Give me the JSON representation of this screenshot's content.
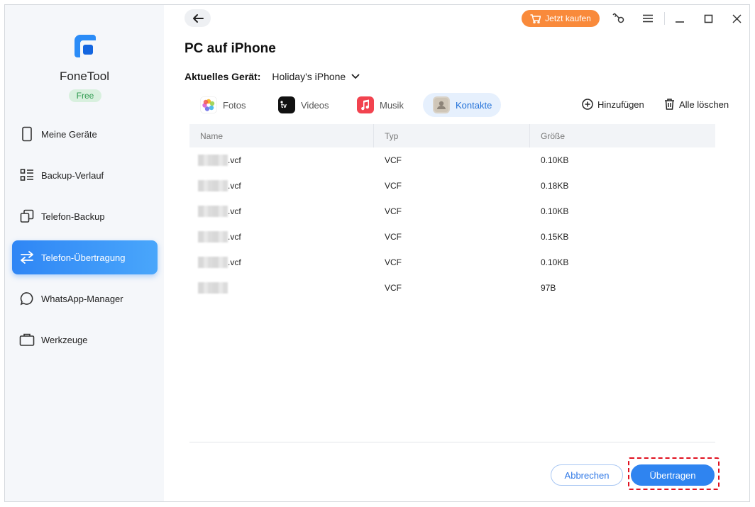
{
  "app": {
    "name": "FoneTool",
    "plan_badge": "Free"
  },
  "sidebar": {
    "items": [
      {
        "label": "Meine Geräte",
        "icon": "phone-icon"
      },
      {
        "label": "Backup-Verlauf",
        "icon": "list-icon"
      },
      {
        "label": "Telefon-Backup",
        "icon": "copy-icon"
      },
      {
        "label": "Telefon-Übertragung",
        "icon": "transfer-icon",
        "active": true
      },
      {
        "label": "WhatsApp-Manager",
        "icon": "chat-bubble-icon"
      },
      {
        "label": "Werkzeuge",
        "icon": "toolbox-icon"
      }
    ]
  },
  "topbar": {
    "buy_label": "Jetzt kaufen",
    "icons": [
      "back-arrow-icon",
      "key-icon",
      "menu-icon",
      "minimize-icon",
      "maximize-icon",
      "close-icon"
    ]
  },
  "page": {
    "title": "PC auf iPhone",
    "device_label": "Aktuelles Gerät:",
    "device_value": "Holiday's iPhone"
  },
  "tabs": [
    {
      "label": "Fotos",
      "icon": "photos-icon"
    },
    {
      "label": "Videos",
      "icon": "apple-tv-icon"
    },
    {
      "label": "Musik",
      "icon": "music-icon"
    },
    {
      "label": "Kontakte",
      "icon": "contacts-icon",
      "active": true
    }
  ],
  "actions": {
    "add_label": "Hinzufügen",
    "delete_all_label": "Alle löschen"
  },
  "table": {
    "columns": [
      "Name",
      "Typ",
      "Größe"
    ],
    "rows": [
      {
        "name_suffix": ".vcf",
        "type": "VCF",
        "size": "0.10KB"
      },
      {
        "name_suffix": ".vcf",
        "type": "VCF",
        "size": "0.18KB"
      },
      {
        "name_suffix": ".vcf",
        "type": "VCF",
        "size": "0.10KB"
      },
      {
        "name_suffix": ".vcf",
        "type": "VCF",
        "size": "0.15KB"
      },
      {
        "name_suffix": ".vcf",
        "type": "VCF",
        "size": "0.10KB"
      },
      {
        "name_suffix": "",
        "type": "VCF",
        "size": "97B"
      }
    ]
  },
  "footer": {
    "cancel_label": "Abbrechen",
    "transfer_label": "Übertragen"
  },
  "colors": {
    "accent": "#2f84f0",
    "buy": "#f98a3b",
    "highlight_frame": "#e0101f"
  }
}
